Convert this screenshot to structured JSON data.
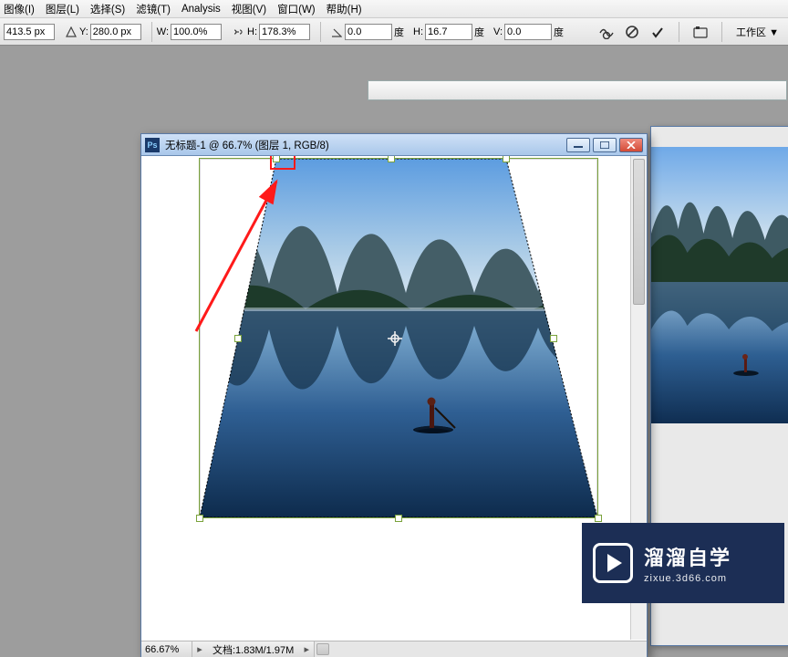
{
  "menu": {
    "image": "图像(I)",
    "layer": "图层(L)",
    "select": "选择(S)",
    "filter": "滤镜(T)",
    "analysis": "Analysis",
    "view": "视图(V)",
    "window": "窗口(W)",
    "help": "帮助(H)"
  },
  "options": {
    "x_value": "413.5 px",
    "y_label": "Y:",
    "y_value": "280.0 px",
    "w_label": "W:",
    "w_value": "100.0%",
    "h_label": "H:",
    "h_value": "178.3%",
    "angle_value": "0.0",
    "angle_unit": "度",
    "hskew_label": "H:",
    "hskew_value": "16.7",
    "hskew_unit": "度",
    "vskew_label": "V:",
    "vskew_value": "0.0",
    "vskew_unit": "度",
    "workspace_label": "工作区 ▼"
  },
  "doc": {
    "title": "无标题-1 @ 66.7% (图层 1, RGB/8)",
    "zoom": "66.67%",
    "docinfo": "文档:1.83M/1.97M"
  },
  "watermark": {
    "brand": "溜溜自学",
    "url": "zixue.3d66.com"
  }
}
